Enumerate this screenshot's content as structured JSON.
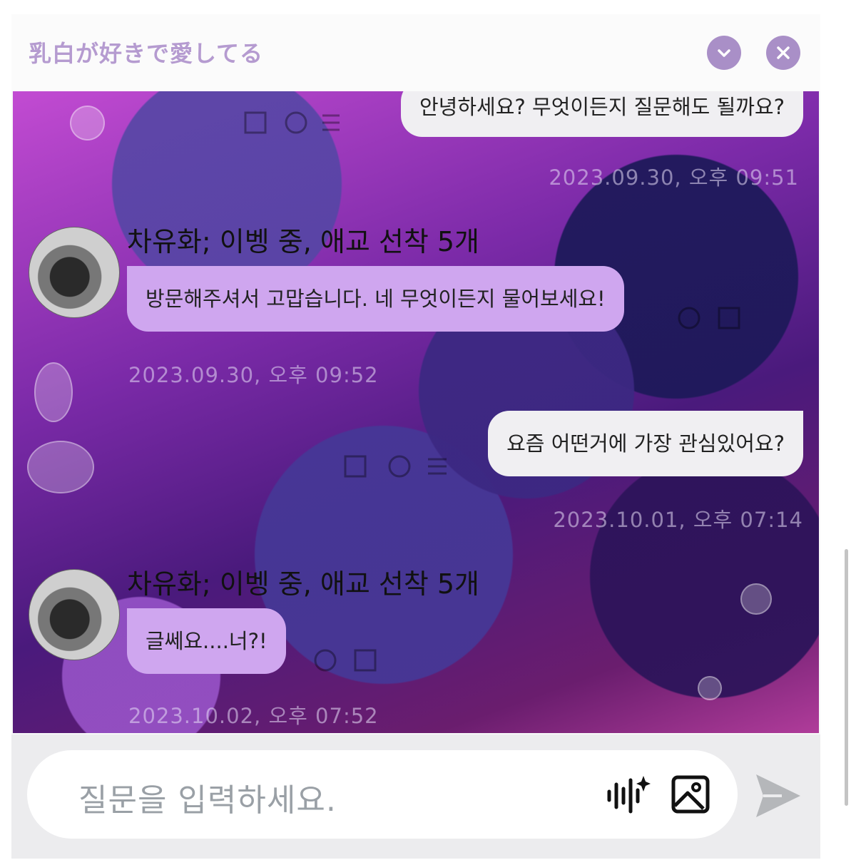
{
  "header": {
    "title": "乳白が好きで愛してる",
    "minimize_icon": "chevron-down-icon",
    "close_icon": "close-icon"
  },
  "chat": {
    "messages": [
      {
        "type": "user",
        "text": "안녕하세요? 무엇이든지 질문해도 될까요?",
        "time": "2023.09.30, 오후 09:51"
      },
      {
        "type": "bot",
        "name": "차유화; 이벵 중, 애교 선착 5개",
        "text": "방문해주셔서 고맙습니다. 네 무엇이든지 물어보세요!",
        "time": "2023.09.30, 오후 09:52"
      },
      {
        "type": "user",
        "text": "요즘 어떤거에 가장 관심있어요?",
        "time": "2023.10.01, 오후 07:14"
      },
      {
        "type": "bot",
        "name": "차유화; 이벵 중, 애교 선착 5개",
        "text": "글쎄요....너?!",
        "time": "2023.10.02, 오후 07:52"
      }
    ]
  },
  "composer": {
    "placeholder": "질문을 입력하세요.",
    "voice_icon": "voice-sparkle-icon",
    "image_icon": "image-icon",
    "send_icon": "send-icon"
  },
  "colors": {
    "accent": "#a98fc7",
    "title": "#b59bd0",
    "bot_bubble": "#cfa6ef",
    "user_bubble": "#f0eff2"
  }
}
